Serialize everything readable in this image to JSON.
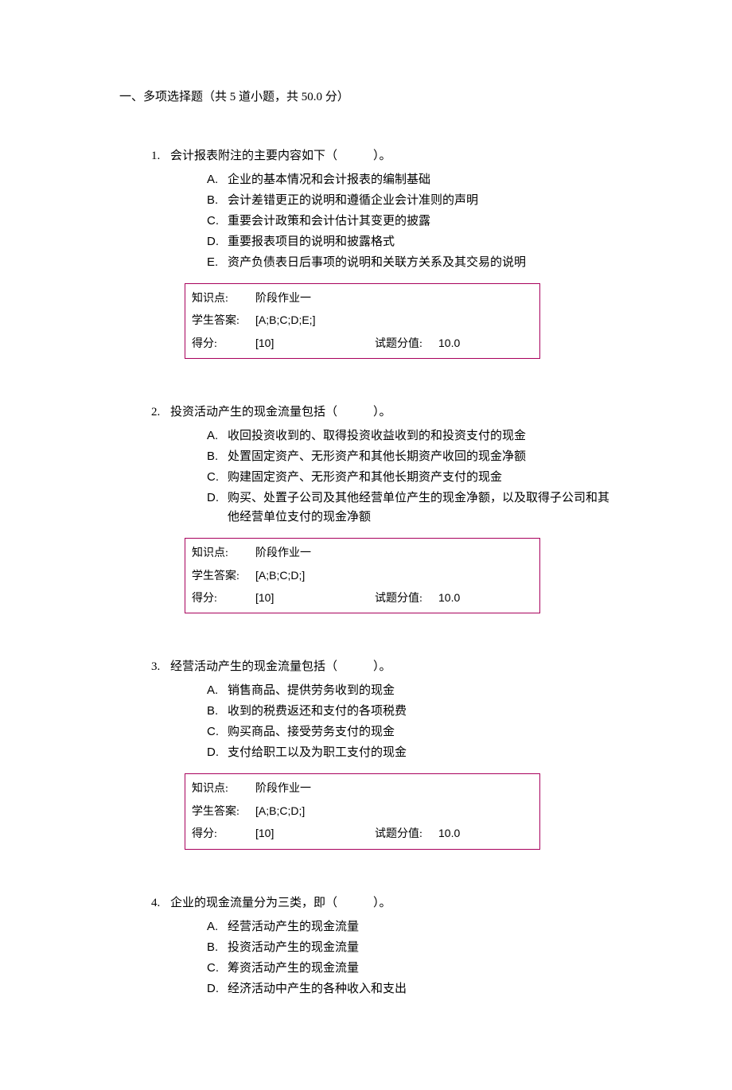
{
  "section_title": "一、多项选择题（共 5 道小题，共 50.0 分）",
  "labels": {
    "knowledge": "知识点:",
    "student_answer": "学生答案:",
    "score": "得分:",
    "full_score": "试题分值:"
  },
  "questions": [
    {
      "num": "1.",
      "stem": "会计报表附注的主要内容如下（　　　）。",
      "options": [
        {
          "label": "A.",
          "text": "企业的基本情况和会计报表的编制基础"
        },
        {
          "label": "B.",
          "text": "会计差错更正的说明和遵循企业会计准则的声明"
        },
        {
          "label": "C.",
          "text": "重要会计政策和会计估计其变更的披露"
        },
        {
          "label": "D.",
          "text": "重要报表项目的说明和披露格式"
        },
        {
          "label": "E.",
          "text": "资产负债表日后事项的说明和关联方关系及其交易的说明"
        }
      ],
      "knowledge": "阶段作业一",
      "answer": "[A;B;C;D;E;]",
      "score": "[10]",
      "full": "10.0"
    },
    {
      "num": "2.",
      "stem": "投资活动产生的现金流量包括（　　　）。",
      "options": [
        {
          "label": "A.",
          "text": "收回投资收到的、取得投资收益收到的和投资支付的现金"
        },
        {
          "label": "B.",
          "text": "处置固定资产、无形资产和其他长期资产收回的现金净额"
        },
        {
          "label": "C.",
          "text": "购建固定资产、无形资产和其他长期资产支付的现金"
        },
        {
          "label": "D.",
          "text": "购买、处置子公司及其他经营单位产生的现金净额，以及取得子公司和其他经营单位支付的现金净额"
        }
      ],
      "knowledge": "阶段作业一",
      "answer": "[A;B;C;D;]",
      "score": "[10]",
      "full": "10.0"
    },
    {
      "num": "3.",
      "stem": "经营活动产生的现金流量包括（　　　）。",
      "options": [
        {
          "label": "A.",
          "text": "销售商品、提供劳务收到的现金"
        },
        {
          "label": "B.",
          "text": "收到的税费返还和支付的各项税费"
        },
        {
          "label": "C.",
          "text": "购买商品、接受劳务支付的现金"
        },
        {
          "label": "D.",
          "text": "支付给职工以及为职工支付的现金"
        }
      ],
      "knowledge": "阶段作业一",
      "answer": "[A;B;C;D;]",
      "score": "[10]",
      "full": "10.0"
    },
    {
      "num": "4.",
      "stem": "企业的现金流量分为三类，即（　　　）。",
      "options": [
        {
          "label": "A.",
          "text": "经营活动产生的现金流量"
        },
        {
          "label": "B.",
          "text": "投资活动产生的现金流量"
        },
        {
          "label": "C.",
          "text": "筹资活动产生的现金流量"
        },
        {
          "label": "D.",
          "text": "经济活动中产生的各种收入和支出"
        }
      ],
      "knowledge": null,
      "answer": null,
      "score": null,
      "full": null
    }
  ]
}
